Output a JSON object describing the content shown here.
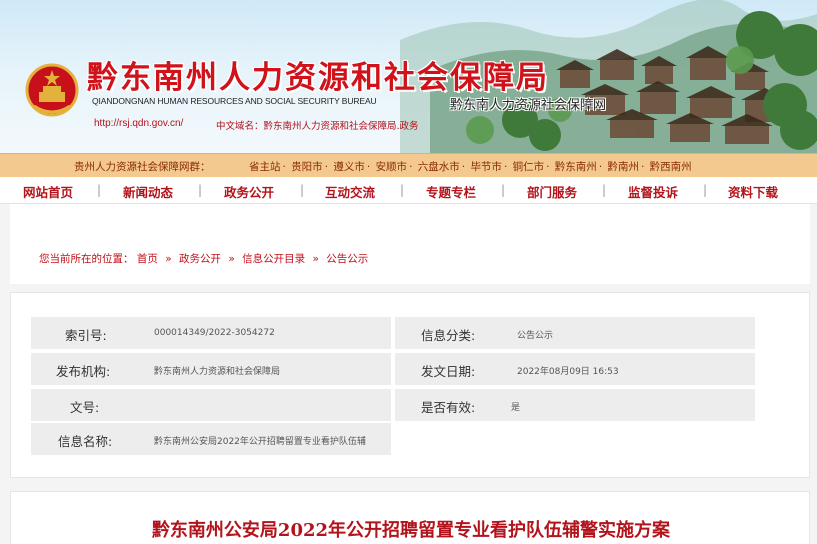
{
  "banner": {
    "title_cn": "黔东南州人力资源和社会保障局",
    "title_en": "QIANDONGNAN HUMAN RESOURCES AND SOCIAL SECURITY BUREAU",
    "title_net": "黔东南人力资源社会保障网",
    "url": "http://rsj.qdn.gov.cn/",
    "domain": "中文域名：黔东南州人力资源和社会保障局.政务"
  },
  "citybar": {
    "label": "贵州人力资源社会保障网群：",
    "links": [
      "省主站",
      "贵阳市",
      "遵义市",
      "安顺市",
      "六盘水市",
      "毕节市",
      "铜仁市",
      "黔东南州",
      "黔南州",
      "黔西南州"
    ]
  },
  "nav": {
    "items": [
      "网站首页",
      "新闻动态",
      "政务公开",
      "互动交流",
      "专题专栏",
      "部门服务",
      "监督投诉",
      "资料下载"
    ],
    "sep": "|"
  },
  "breadcrumb": {
    "lead": "您当前所在的位置：",
    "items": [
      "首页",
      "政务公开",
      "信息公开目录",
      "公告公示"
    ],
    "arrow": "»"
  },
  "meta": {
    "index_label": "索引号:",
    "index_value": "000014349/2022-3054272",
    "category_label": "信息分类:",
    "category_value": "公告公示",
    "publisher_label": "发布机构:",
    "publisher_value": "黔东南州人力资源和社会保障局",
    "date_label": "发文日期:",
    "date_value": "2022年08月09日  16:53",
    "docno_label": "文号:",
    "docno_value": "",
    "valid_label": "是否有效:",
    "valid_value": "是",
    "name_label": "信息名称:",
    "name_value": "黔东南州公安局2022年公开招聘留置专业看护队伍辅"
  },
  "article": {
    "title": "黔东南州公安局2022年公开招聘留置专业看护队伍辅警实施方案"
  },
  "colors": {
    "brand_red": "#d0121b",
    "nav_red": "#b3141c",
    "citybar_bg": "#f3c98f",
    "meta_bg": "#ededed"
  },
  "icons": {
    "emblem": "national-emblem-icon"
  }
}
